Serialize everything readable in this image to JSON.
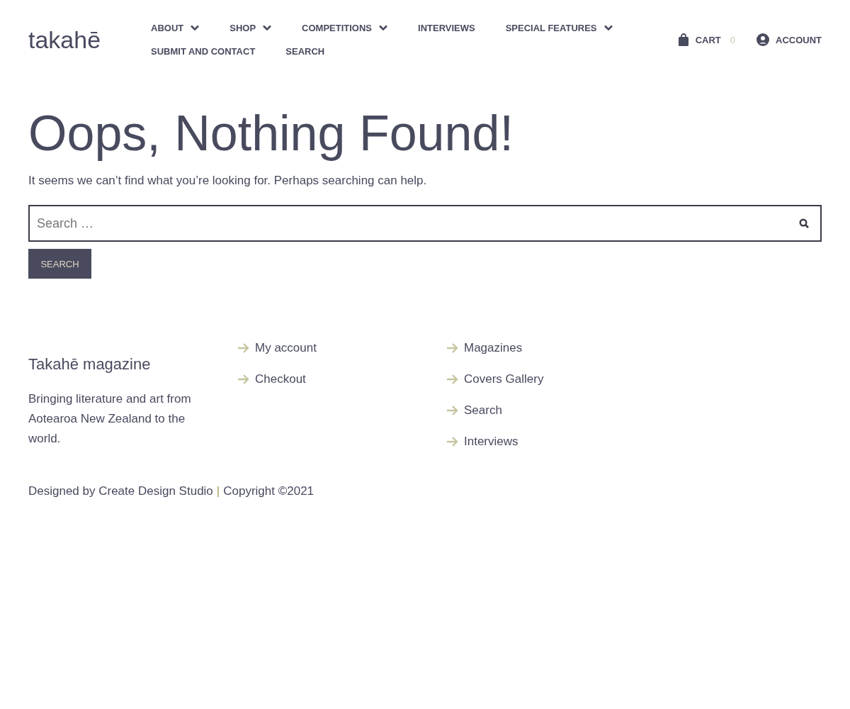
{
  "logo": "takahē",
  "nav": [
    {
      "label": "ABOUT",
      "has_submenu": true
    },
    {
      "label": "SHOP",
      "has_submenu": true
    },
    {
      "label": "COMPETITIONS",
      "has_submenu": true
    },
    {
      "label": "INTERVIEWS",
      "has_submenu": false
    },
    {
      "label": "SPECIAL FEATURES",
      "has_submenu": true
    },
    {
      "label": "SUBMIT AND CONTACT",
      "has_submenu": false
    },
    {
      "label": "SEARCH",
      "has_submenu": false
    }
  ],
  "cart": {
    "label": "CART",
    "count": "0"
  },
  "account": {
    "label": "ACCOUNT"
  },
  "heading": "Oops, Nothing Found!",
  "message": "It seems we can’t find what you’re looking for. Perhaps searching can help.",
  "search": {
    "placeholder": "Search …",
    "button": "SEARCH"
  },
  "footer": {
    "title": "Takahē magazine",
    "about": "Bringing literature and art from Aotearoa New Zealand to the world.",
    "links_1": [
      "My account",
      "Checkout"
    ],
    "links_2": [
      "Magazines",
      "Covers Gallery",
      "Search",
      "Interviews"
    ],
    "credit": "Designed by Create Design Studio",
    "separator": "|",
    "copyright": "Copyright ©2021"
  }
}
